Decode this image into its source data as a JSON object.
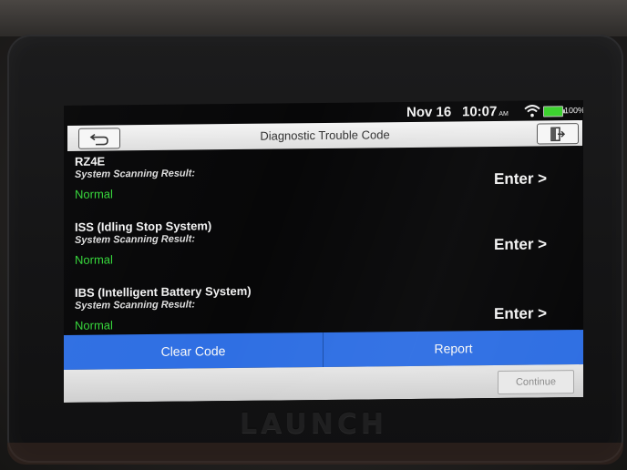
{
  "brand": "LAUNCH",
  "status_bar": {
    "date": "Nov 16",
    "time": "10:07",
    "ampm": "AM",
    "battery": "100%",
    "icons": [
      "wifi-icon",
      "battery-icon"
    ],
    "battery_color": "#39d12b"
  },
  "title_bar": {
    "title": "Diagnostic Trouble Code",
    "back_icon": "back-arrow-icon",
    "exit_icon": "exit-icon"
  },
  "systems": [
    {
      "name": "RZ4E",
      "label": "System Scanning Result:",
      "status": "Normal",
      "enter": "Enter >"
    },
    {
      "name": "ISS (Idling Stop System)",
      "label": "System Scanning Result:",
      "status": "Normal",
      "enter": "Enter >"
    },
    {
      "name": "IBS (Intelligent Battery System)",
      "label": "System Scanning Result:",
      "status": "Normal",
      "enter": "Enter >"
    }
  ],
  "actions": {
    "clear_code": "Clear Code",
    "report": "Report",
    "continue": "Continue"
  },
  "colors": {
    "accent_blue": "#2f6fe3",
    "status_green": "#35d63a",
    "screen_bg": "#070708"
  }
}
